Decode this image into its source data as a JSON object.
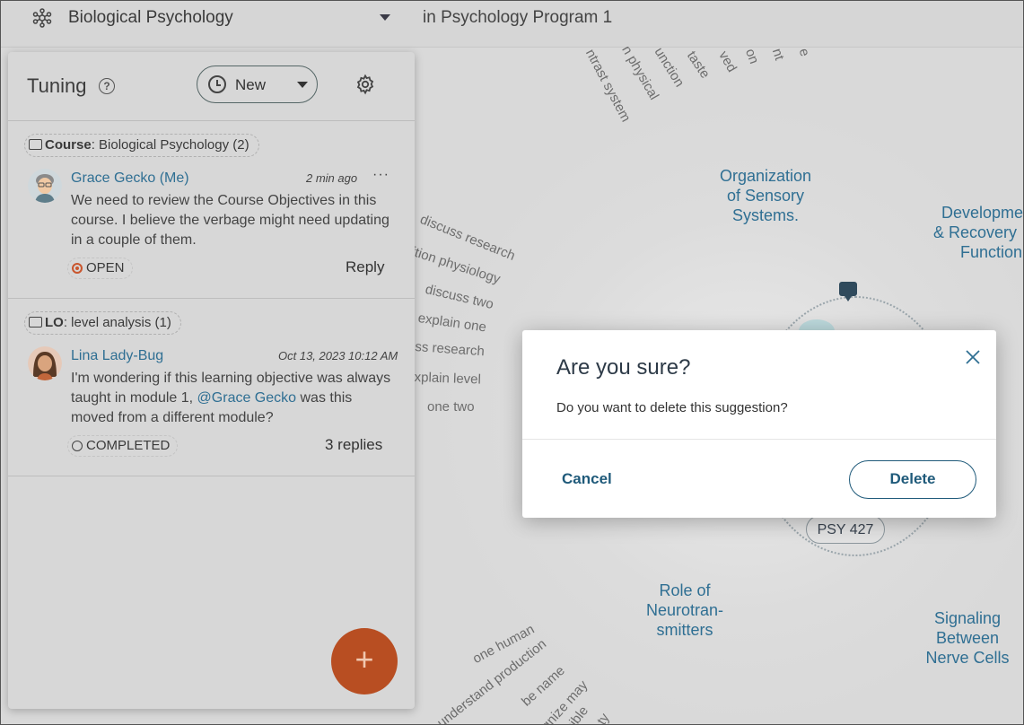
{
  "topbar": {
    "course_name": "Biological Psychology",
    "program": "in Psychology Program 1",
    "logo_icon": "network-icon"
  },
  "map": {
    "radial_words_top": [
      "ntrast system",
      "n physical",
      "unction",
      "taste",
      "ved",
      "on",
      "nt",
      "e"
    ],
    "radial_words_left": [
      "discuss research",
      "ition physiology",
      "discuss two",
      "explain one",
      "ss research",
      "xplain level",
      "one two"
    ],
    "radial_words_bottom": [
      "one human",
      "understand production",
      "be name",
      "gnize may",
      "ssible",
      "ty"
    ],
    "topics": [
      {
        "lines": [
          "Organization",
          "of Sensory",
          "Systems."
        ]
      },
      {
        "lines": [
          "Developme",
          "& Recovery",
          "Function"
        ]
      },
      {
        "lines": [
          "Role of",
          "Neurotran-",
          "smitters"
        ]
      },
      {
        "lines": [
          "Signaling",
          "Between",
          "Nerve Cells"
        ]
      }
    ],
    "node_label": "PSY 427"
  },
  "panel": {
    "title": "Tuning",
    "filter_label": "New",
    "threads": [
      {
        "tag_type": "Course",
        "tag_text": ": Biological Psychology (2)",
        "author": "Grace Gecko (Me)",
        "time": "2 min ago",
        "more": "···",
        "message": "We need to review the Course Objectives in this course. I believe the verbage might need updating in a couple of them.",
        "status": "OPEN",
        "action": "Reply"
      },
      {
        "tag_type": "LO",
        "tag_text": ": level analysis (1)",
        "author": "Lina Lady-Bug",
        "time": "Oct 13, 2023 10:12 AM",
        "message_pre": "I'm wondering if this learning objective was always taught in module 1, ",
        "mention": "@Grace Gecko",
        "message_post": " was this moved from a different module?",
        "status": "COMPLETED",
        "action": "3 replies"
      }
    ],
    "fab_label": "+"
  },
  "modal": {
    "title": "Are you sure?",
    "body": "Do you want to delete this suggestion?",
    "cancel_label": "Cancel",
    "delete_label": "Delete"
  },
  "colors": {
    "accent": "#2f6f93",
    "fab": "#b84e22",
    "open_status": "#c9562e",
    "modal_button": "#1f5a7a"
  }
}
